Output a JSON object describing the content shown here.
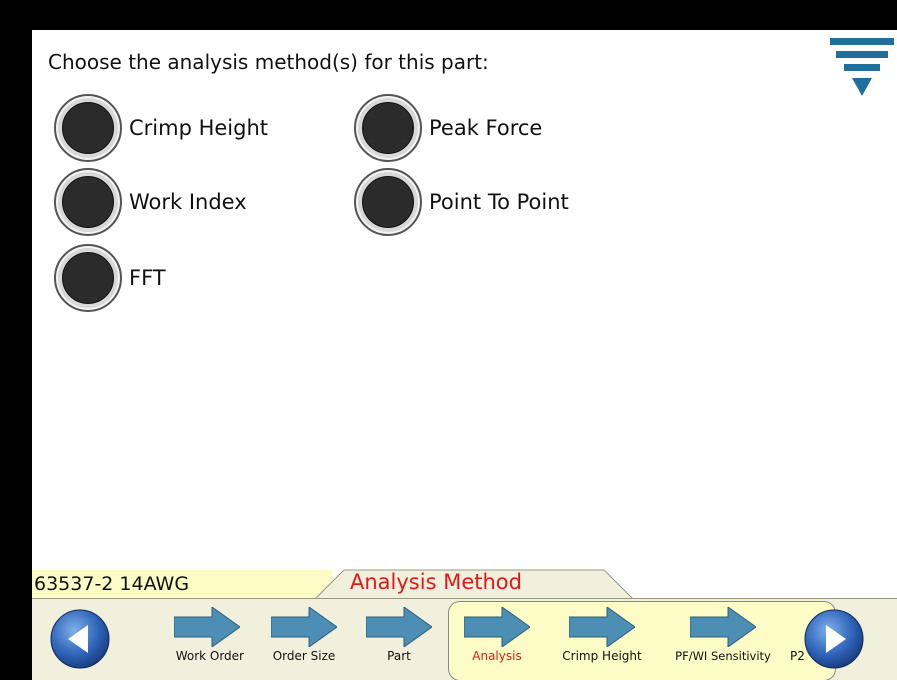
{
  "prompt": "Choose the analysis method(s) for this part:",
  "options": [
    {
      "label": "Crimp Height"
    },
    {
      "label": "Peak Force"
    },
    {
      "label": "Work Index"
    },
    {
      "label": "Point To Point"
    },
    {
      "label": "FFT"
    }
  ],
  "status": {
    "part_id": "63537-2 14AWG",
    "current_step_title": "Analysis Method"
  },
  "steps": [
    {
      "label": "Work Order"
    },
    {
      "label": "Order Size"
    },
    {
      "label": "Part"
    },
    {
      "label": "Analysis"
    },
    {
      "label": "Crimp Height"
    },
    {
      "label": "PF/WI Sensitivity"
    },
    {
      "label": "P2"
    }
  ],
  "colors": {
    "accent_red": "#e0181b",
    "arrow_blue": "#4d8fb4",
    "nav_button_blue": "#2f64b8",
    "status_yellow": "#fdfcc6",
    "menu_icon_blue": "#1f6f9a"
  },
  "icons": {
    "menu": "menu-filter-icon",
    "prev": "left-arrow-icon",
    "next": "right-arrow-icon",
    "step": "right-arrow-icon"
  }
}
